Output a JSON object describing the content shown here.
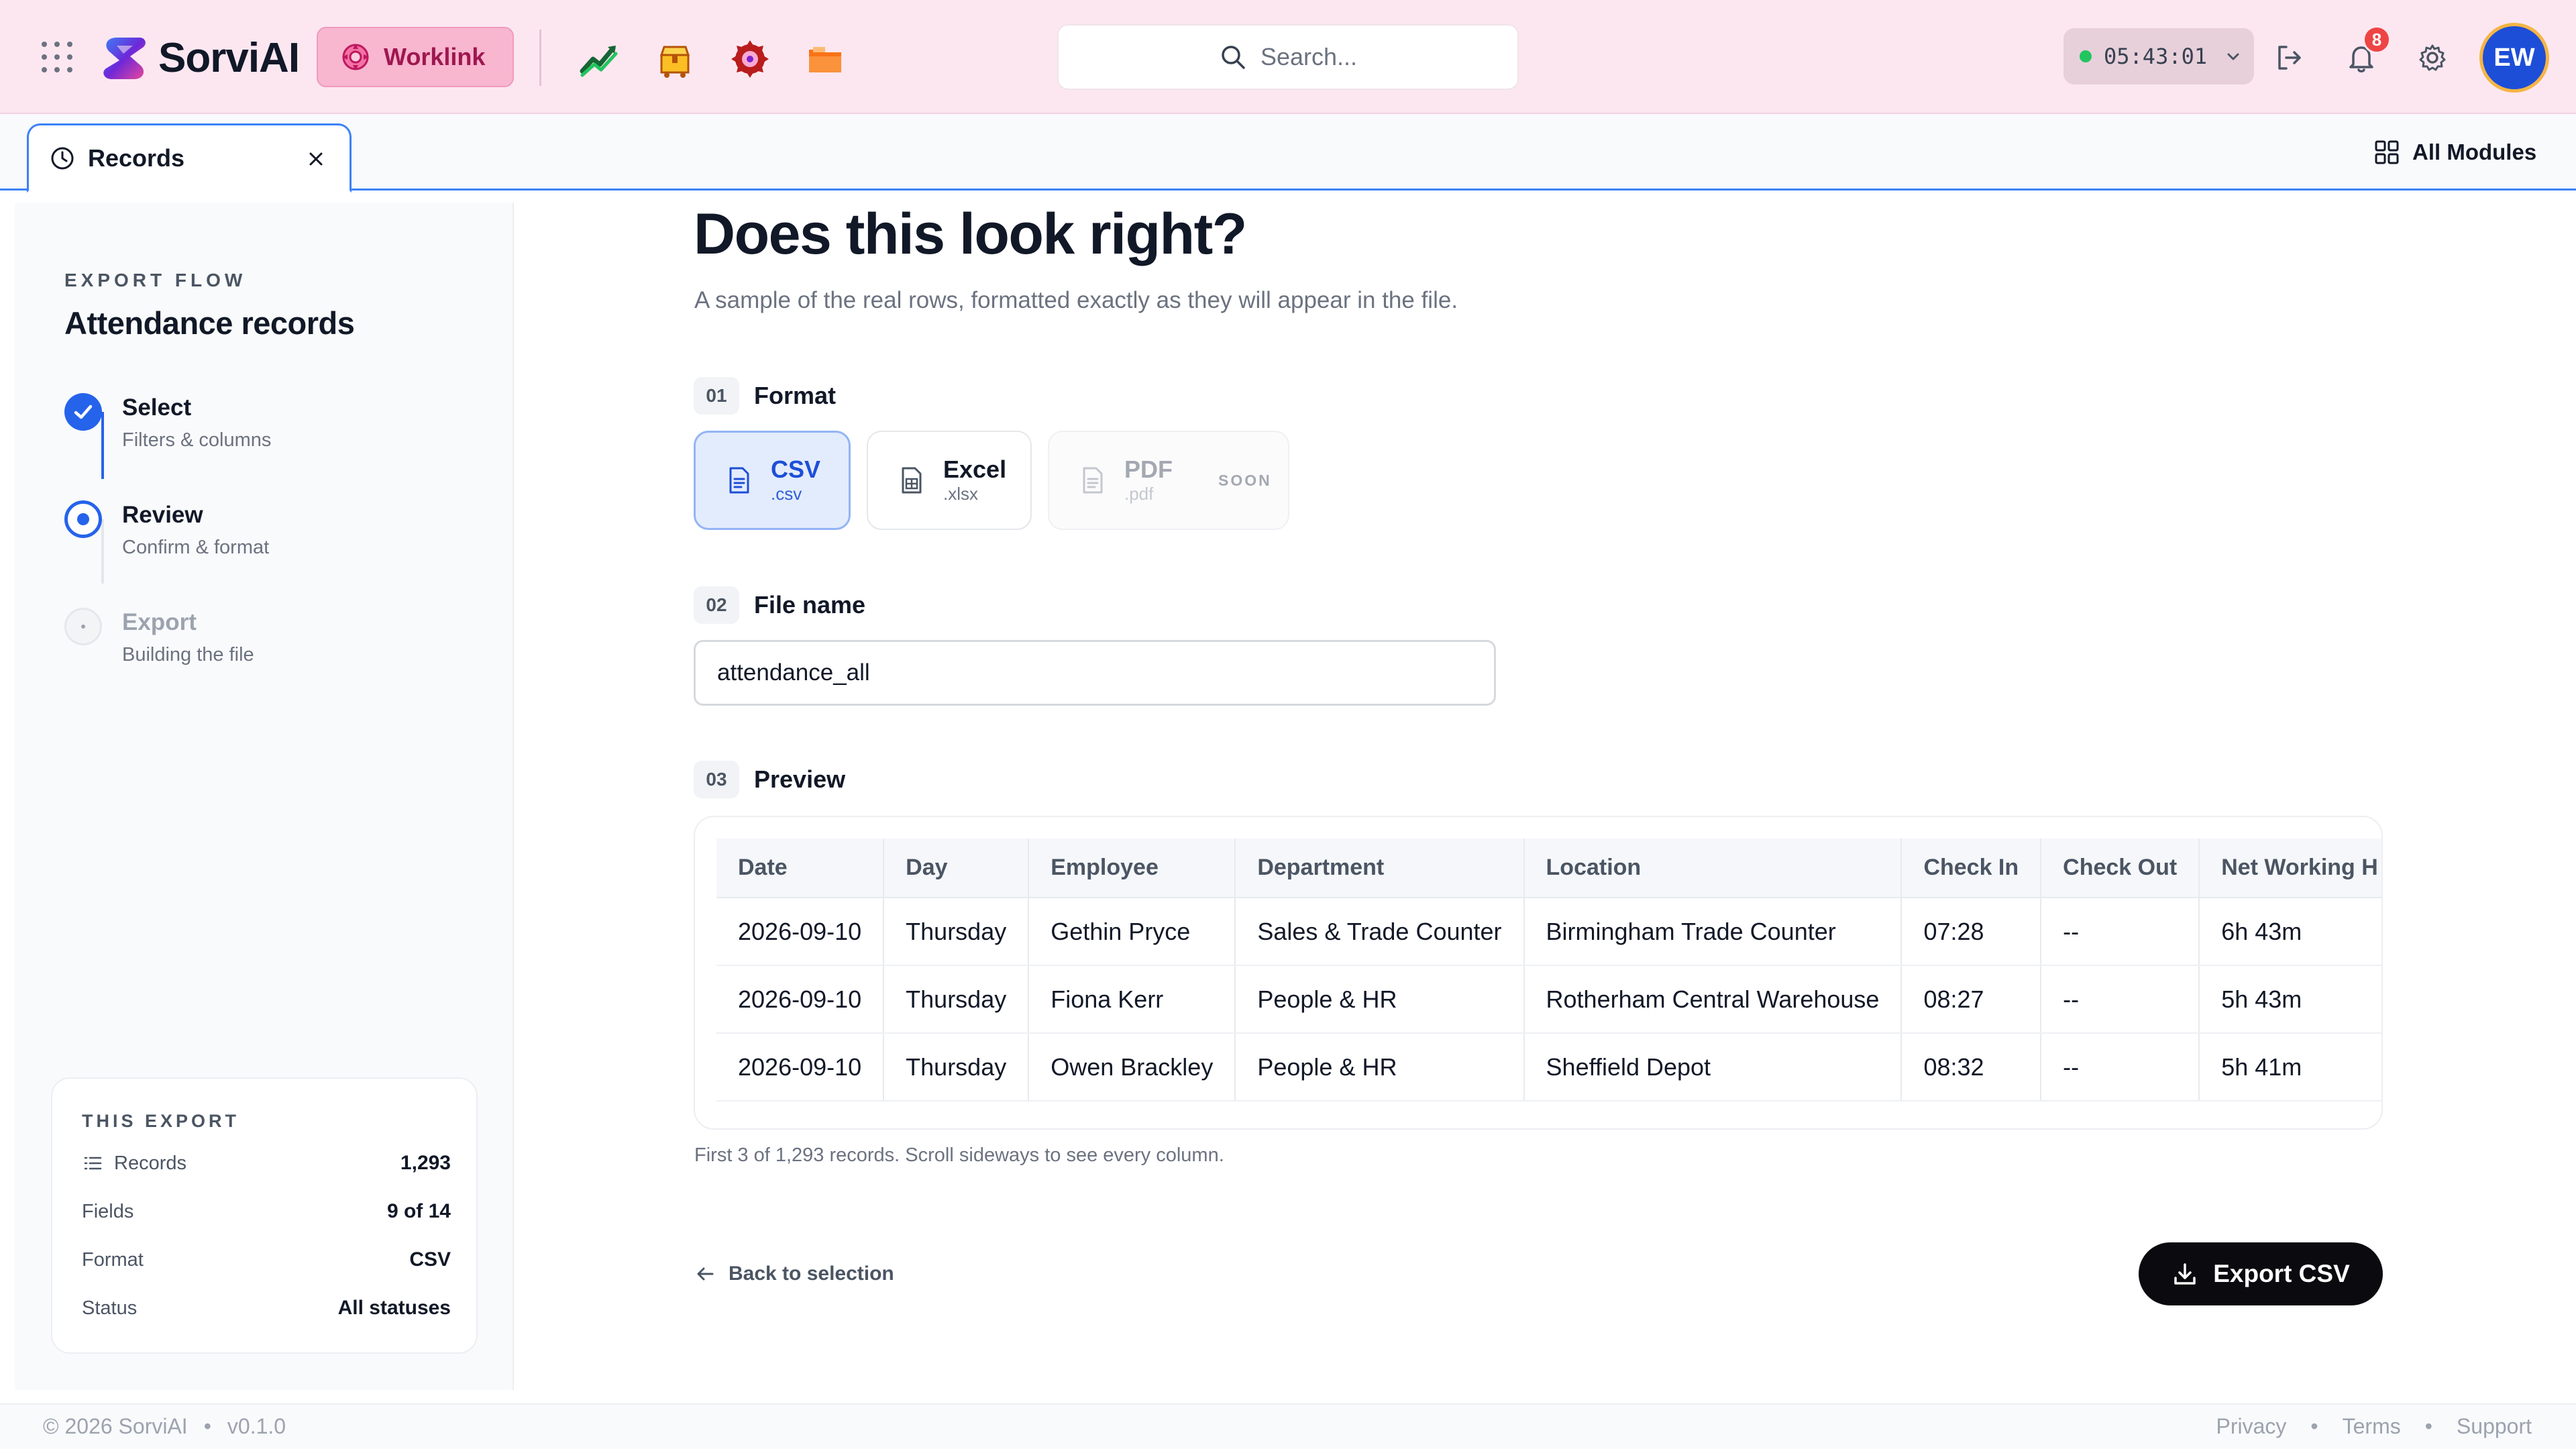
{
  "app": {
    "name": "SorviAI",
    "active_module": "Worklink",
    "colors": {
      "accent": "#1d4ed8",
      "brand_pink": "#fce7f1",
      "worklink": "#9f1750"
    }
  },
  "header": {
    "search_placeholder": "Search...",
    "timer": "05:43:01",
    "notifications_count": "8",
    "avatar_initials": "EW",
    "modules": [
      "trending-chart-icon",
      "delivery-box-icon",
      "gear-target-icon",
      "folder-icon"
    ]
  },
  "tabs": {
    "active_tab": "Records",
    "all_modules_label": "All Modules"
  },
  "sidebar": {
    "eyebrow": "EXPORT FLOW",
    "title": "Attendance records",
    "steps": [
      {
        "title": "Select",
        "subtitle": "Filters & columns",
        "state": "done"
      },
      {
        "title": "Review",
        "subtitle": "Confirm & format",
        "state": "current"
      },
      {
        "title": "Export",
        "subtitle": "Building the file",
        "state": "pending"
      }
    ],
    "summary": {
      "eyebrow": "THIS EXPORT",
      "rows": [
        {
          "key": "Records",
          "value": "1,293"
        },
        {
          "key": "Fields",
          "value": "9 of 14"
        },
        {
          "key": "Format",
          "value": "CSV"
        },
        {
          "key": "Status",
          "value": "All statuses"
        }
      ]
    }
  },
  "main": {
    "heading": "Does this look right?",
    "lead": "A sample of the real rows, formatted exactly as they will appear in the file.",
    "format_section": {
      "num": "01",
      "label": "Format"
    },
    "formats": [
      {
        "title": "CSV",
        "ext": ".csv",
        "state": "selected"
      },
      {
        "title": "Excel",
        "ext": ".xlsx",
        "state": "available"
      },
      {
        "title": "PDF",
        "ext": ".pdf",
        "state": "disabled",
        "badge": "SOON"
      }
    ],
    "filename_section": {
      "num": "02",
      "label": "File name"
    },
    "filename_value": "attendance_all",
    "preview_section": {
      "num": "03",
      "label": "Preview"
    },
    "preview": {
      "columns": [
        "Date",
        "Day",
        "Employee",
        "Department",
        "Location",
        "Check In",
        "Check Out",
        "Net Working H"
      ],
      "rows": [
        [
          "2026-09-10",
          "Thursday",
          "Gethin Pryce",
          "Sales & Trade Counter",
          "Birmingham Trade Counter",
          "07:28",
          "--",
          "6h 43m"
        ],
        [
          "2026-09-10",
          "Thursday",
          "Fiona Kerr",
          "People & HR",
          "Rotherham Central Warehouse",
          "08:27",
          "--",
          "5h 43m"
        ],
        [
          "2026-09-10",
          "Thursday",
          "Owen Brackley",
          "People & HR",
          "Sheffield Depot",
          "08:32",
          "--",
          "5h 41m"
        ]
      ]
    },
    "caption": "First 3 of 1,293 records. Scroll sideways to see every column.",
    "back_label": "Back to selection",
    "export_label": "Export CSV"
  },
  "footer": {
    "copyright": "© 2026 SorviAI",
    "version": "v0.1.0",
    "links": [
      "Privacy",
      "Terms",
      "Support"
    ]
  }
}
